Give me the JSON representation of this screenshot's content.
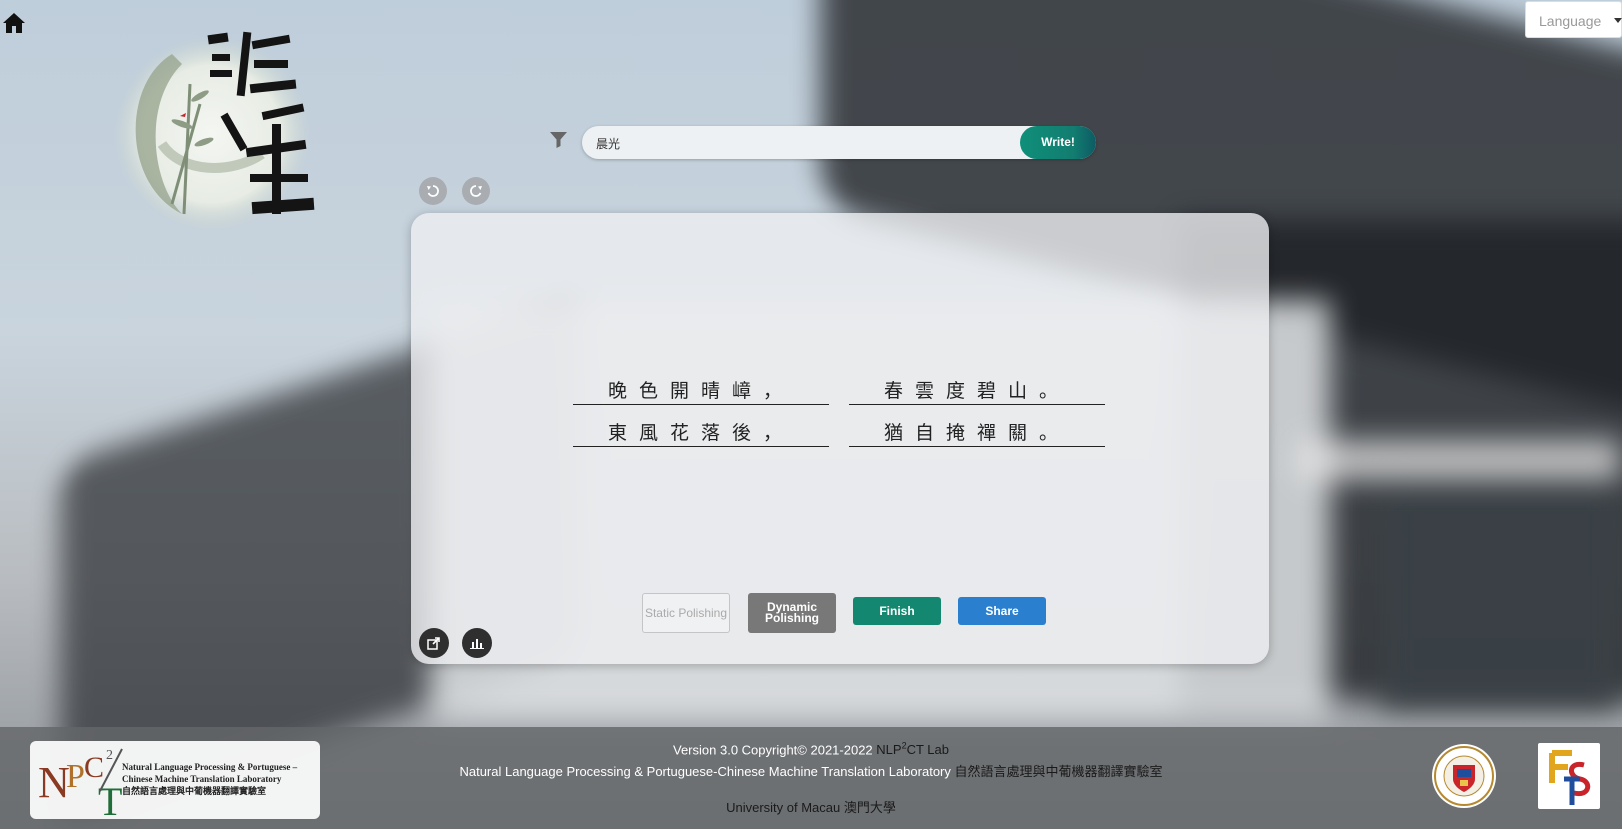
{
  "nav": {
    "home_icon": "home-icon",
    "language_label": "Language"
  },
  "logo": {
    "icon": "calligraphy-logo-icon"
  },
  "search": {
    "value": "晨光",
    "filter_icon": "filter-icon",
    "write_label": "Write!"
  },
  "history": {
    "undo_icon": "undo-icon",
    "redo_icon": "redo-icon"
  },
  "poem": {
    "lines": [
      {
        "first": "晚色開晴嶂，",
        "second": "春雲度碧山。"
      },
      {
        "first": "東風花落後，",
        "second": "猶自掩禪關。"
      }
    ]
  },
  "actions": {
    "static_polishing": "Static Polishing",
    "dynamic_polishing": "Dynamic Polishing",
    "finish": "Finish",
    "share": "Share",
    "export_icon": "export-icon",
    "chart_icon": "bar-chart-icon"
  },
  "footer": {
    "version_line": "Version 3.0 Copyright© 2021-2022",
    "lab_short": "NLP",
    "lab_sup": "2",
    "lab_short_suffix": "CT Lab",
    "lab_full_en": "Natural Language Processing & Portuguese-Chinese Machine Translation Laboratory",
    "lab_full_zh": "自然語言處理與中葡機器翻譯實驗室",
    "university_en": "University of Macau",
    "university_zh": "澳門大學",
    "nlp_logo_text": [
      "Natural Language Processing & Portuguese –",
      "Chinese Machine Translation Laboratory",
      "自然語言處理與中葡機器翻譯實驗室"
    ],
    "um_logo": "university-of-macau-seal-icon",
    "fst_logo": "fst-logo-icon"
  },
  "colors": {
    "accent_green": "#13876f",
    "accent_blue": "#2a80cf",
    "write_gradient_start": "#0f8f7a"
  }
}
